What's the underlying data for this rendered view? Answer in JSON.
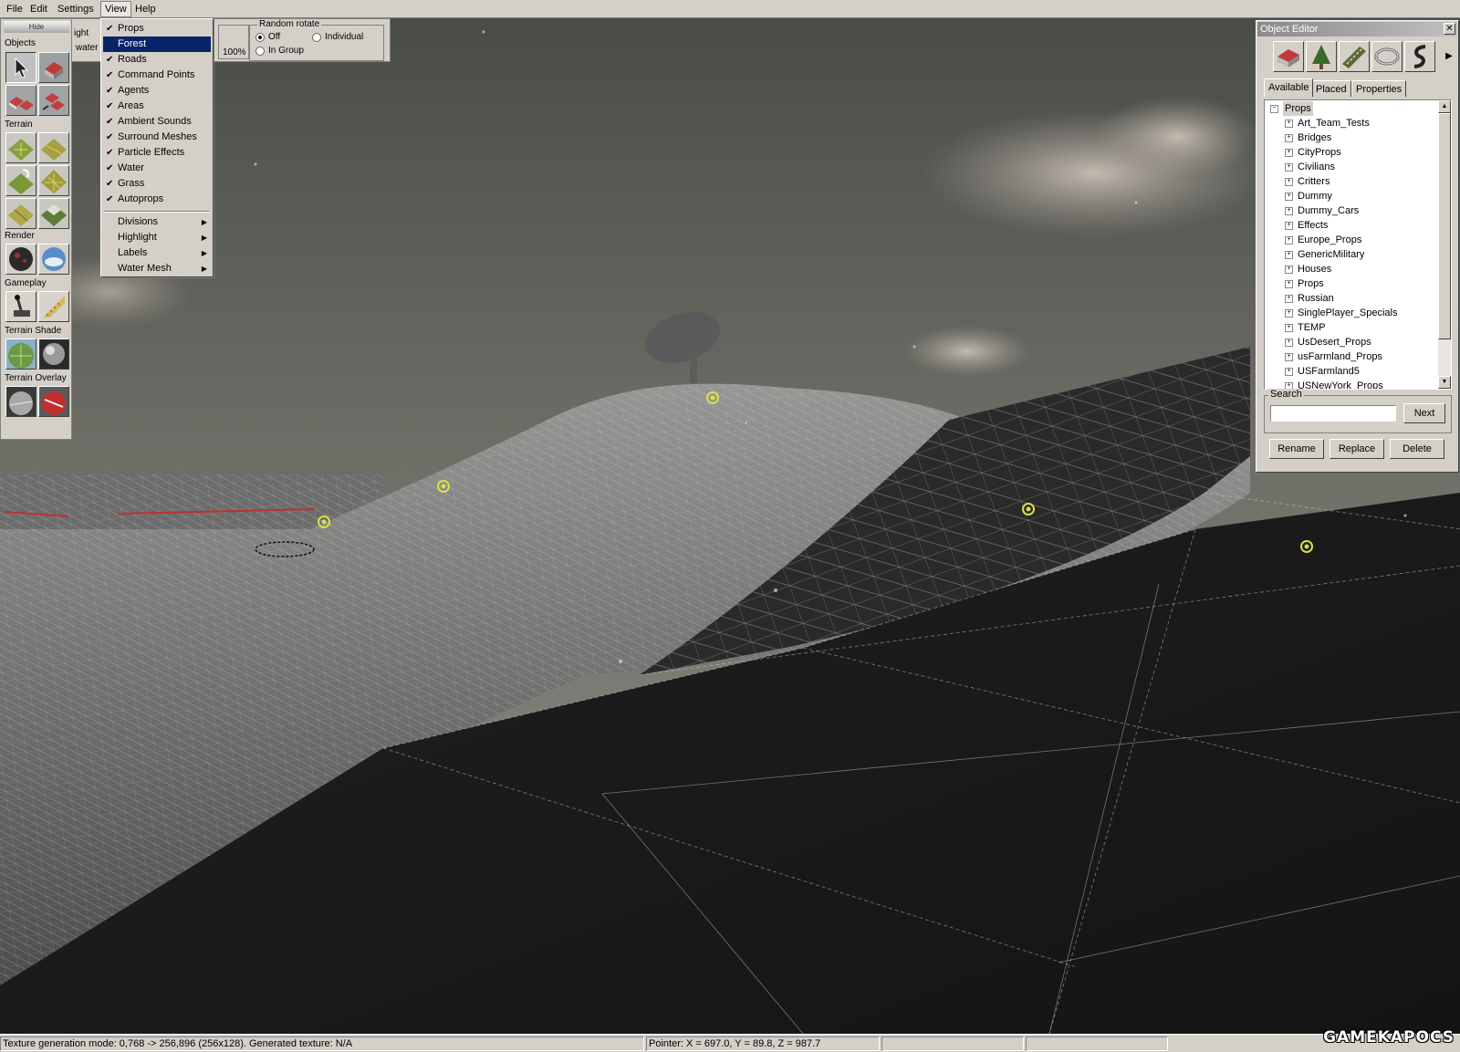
{
  "menubar": {
    "items": [
      {
        "label": "File"
      },
      {
        "label": "Edit"
      },
      {
        "label": "Settings"
      },
      {
        "label": "View"
      },
      {
        "label": "Help"
      }
    ]
  },
  "view_menu": {
    "items": [
      {
        "label": "Props",
        "checked": true
      },
      {
        "label": "Forest",
        "checked": false,
        "selected": true
      },
      {
        "label": "Roads",
        "checked": true
      },
      {
        "label": "Command Points",
        "checked": true
      },
      {
        "label": "Agents",
        "checked": true
      },
      {
        "label": "Areas",
        "checked": true
      },
      {
        "label": "Ambient Sounds",
        "checked": true
      },
      {
        "label": "Surround Meshes",
        "checked": true
      },
      {
        "label": "Particle Effects",
        "checked": true
      },
      {
        "label": "Water",
        "checked": true
      },
      {
        "label": "Grass",
        "checked": true
      },
      {
        "label": "Autoprops",
        "checked": true
      }
    ],
    "submenus": [
      {
        "label": "Divisions"
      },
      {
        "label": "Highlight"
      },
      {
        "label": "Labels"
      },
      {
        "label": "Water Mesh"
      }
    ],
    "check_glyph": "✔",
    "arrow_glyph": "▶"
  },
  "toolstrip": {
    "height_label": "ight",
    "water_label": "water",
    "zoom": "100%",
    "random_rotate": {
      "title": "Random rotate",
      "options": [
        {
          "label": "Off",
          "checked": true
        },
        {
          "label": "Individual",
          "checked": false
        },
        {
          "label": "In Group",
          "checked": false
        }
      ]
    }
  },
  "palette": {
    "hide_label": "Hide",
    "sections": [
      {
        "label": "Objects"
      },
      {
        "label": "Terrain"
      },
      {
        "label": "Render"
      },
      {
        "label": "Gameplay"
      },
      {
        "label": "Terrain Shade"
      },
      {
        "label": "Terrain Overlay"
      }
    ]
  },
  "object_editor": {
    "title": "Object Editor",
    "close_glyph": "✕",
    "category_icons": [
      "house-icon",
      "tree-icon",
      "road-icon",
      "ring-icon",
      "path-icon"
    ],
    "tabs": [
      {
        "label": "Available",
        "active": true
      },
      {
        "label": "Placed",
        "active": false
      },
      {
        "label": "Properties",
        "active": false
      }
    ],
    "tree": {
      "root": "Props",
      "children": [
        "Art_Team_Tests",
        "Bridges",
        "CityProps",
        "Civilians",
        "Critters",
        "Dummy",
        "Dummy_Cars",
        "Effects",
        "Europe_Props",
        "GenericMilitary",
        "Houses",
        "Props",
        "Russian",
        "SinglePlayer_Specials",
        "TEMP",
        "UsDesert_Props",
        "usFarmland_Props",
        "USFarmland5",
        "USNewYork_Props"
      ]
    },
    "search": {
      "title": "Search",
      "value": "",
      "next_label": "Next"
    },
    "buttons": {
      "rename": "Rename",
      "replace": "Replace",
      "delete": "Delete"
    }
  },
  "statusbar": {
    "texture_info": "Texture generation mode: 0,768 -> 256,896 (256x128). Generated texture: N/A",
    "pointer": "Pointer: X = 697.0, Y = 89.8, Z = 987.7",
    "panel3": "",
    "panel4": ""
  },
  "watermark": "GAMEKAPOCS",
  "colors": {
    "chrome": "#d4d0c8",
    "menu_highlight": "#0a246a",
    "marker": "#d8e04a",
    "red_line": "#c03030"
  }
}
